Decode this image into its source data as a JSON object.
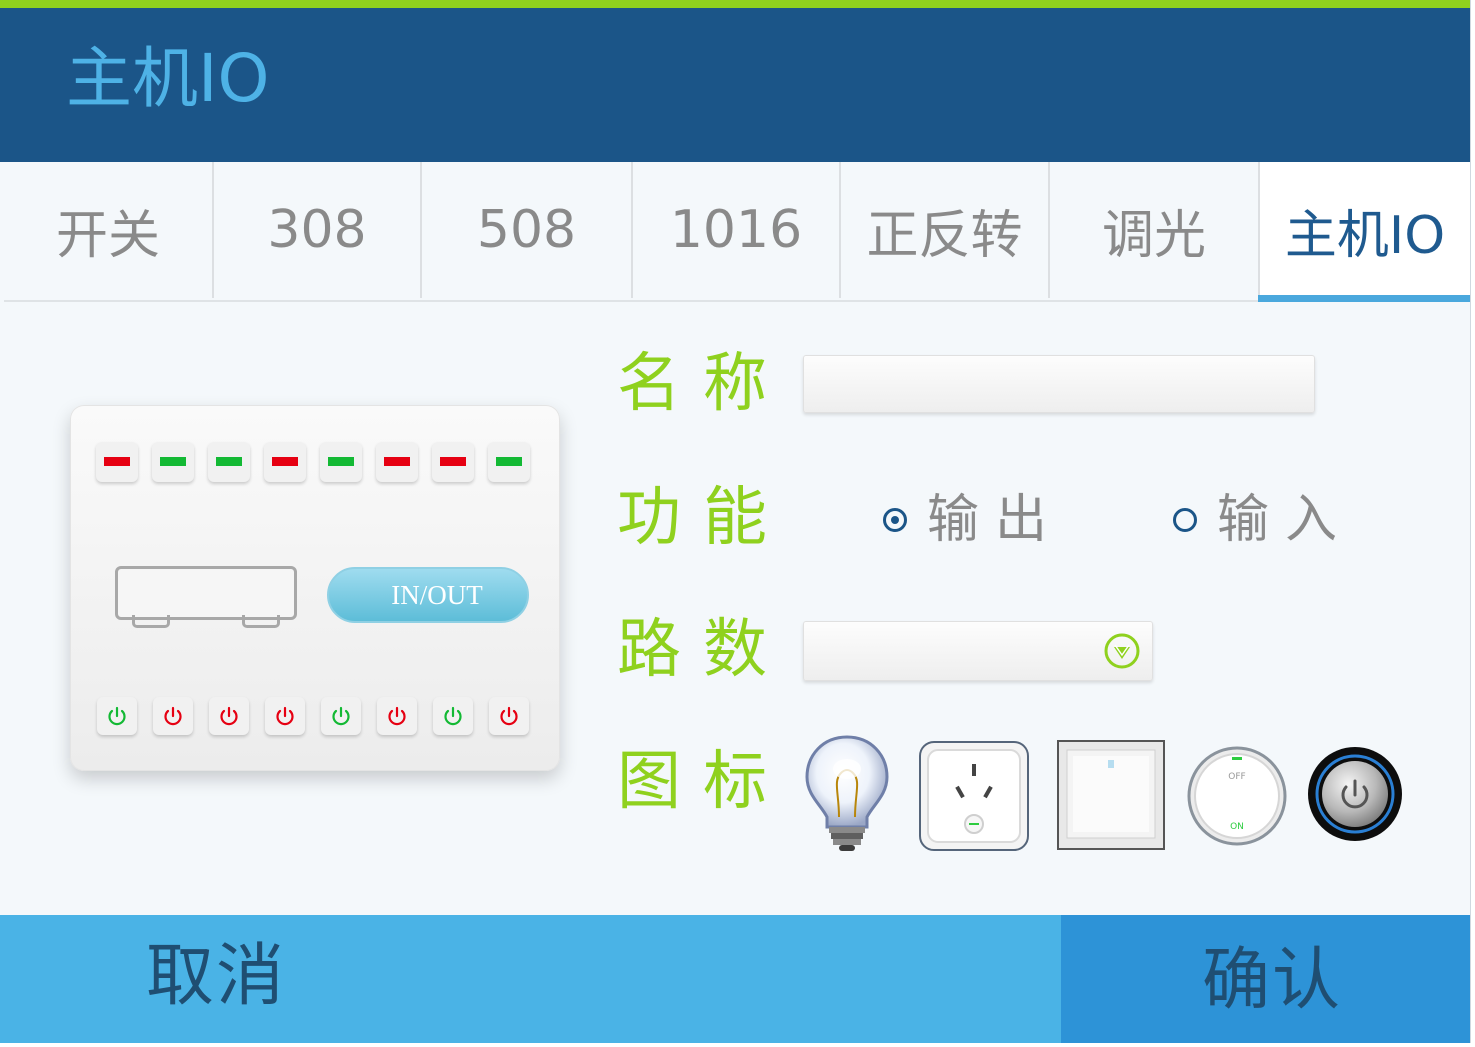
{
  "header": {
    "title": "主机IO"
  },
  "tabs": [
    {
      "label": "开关"
    },
    {
      "label": "308"
    },
    {
      "label": "508"
    },
    {
      "label": "1016"
    },
    {
      "label": "正反转"
    },
    {
      "label": "调光"
    },
    {
      "label": "主机IO",
      "active": true
    }
  ],
  "device": {
    "leds": [
      "red",
      "green",
      "green",
      "red",
      "green",
      "red",
      "red",
      "green"
    ],
    "power_buttons": [
      "green",
      "red",
      "red",
      "red",
      "green",
      "red",
      "green",
      "red"
    ],
    "mode_button_label": "IN/OUT"
  },
  "form": {
    "name_label": "名称",
    "name_value": "",
    "function_label": "功能",
    "function_options": [
      {
        "label": "输出",
        "selected": true
      },
      {
        "label": "输入",
        "selected": false
      }
    ],
    "channel_label": "路数",
    "channel_value": "",
    "icon_label": "图标",
    "icons": [
      "light-bulb-icon",
      "power-socket-icon",
      "wall-switch-icon",
      "off-on-toggle-icon",
      "power-knob-icon"
    ]
  },
  "footer": {
    "cancel_label": "取消",
    "confirm_label": "确认"
  },
  "colors": {
    "header_bg": "#1b5588",
    "accent_green": "#8fd11e",
    "accent_blue": "#4ab3e6",
    "confirm_bg": "#2d93d7",
    "led_red": "#e60012",
    "led_green": "#13b934"
  }
}
